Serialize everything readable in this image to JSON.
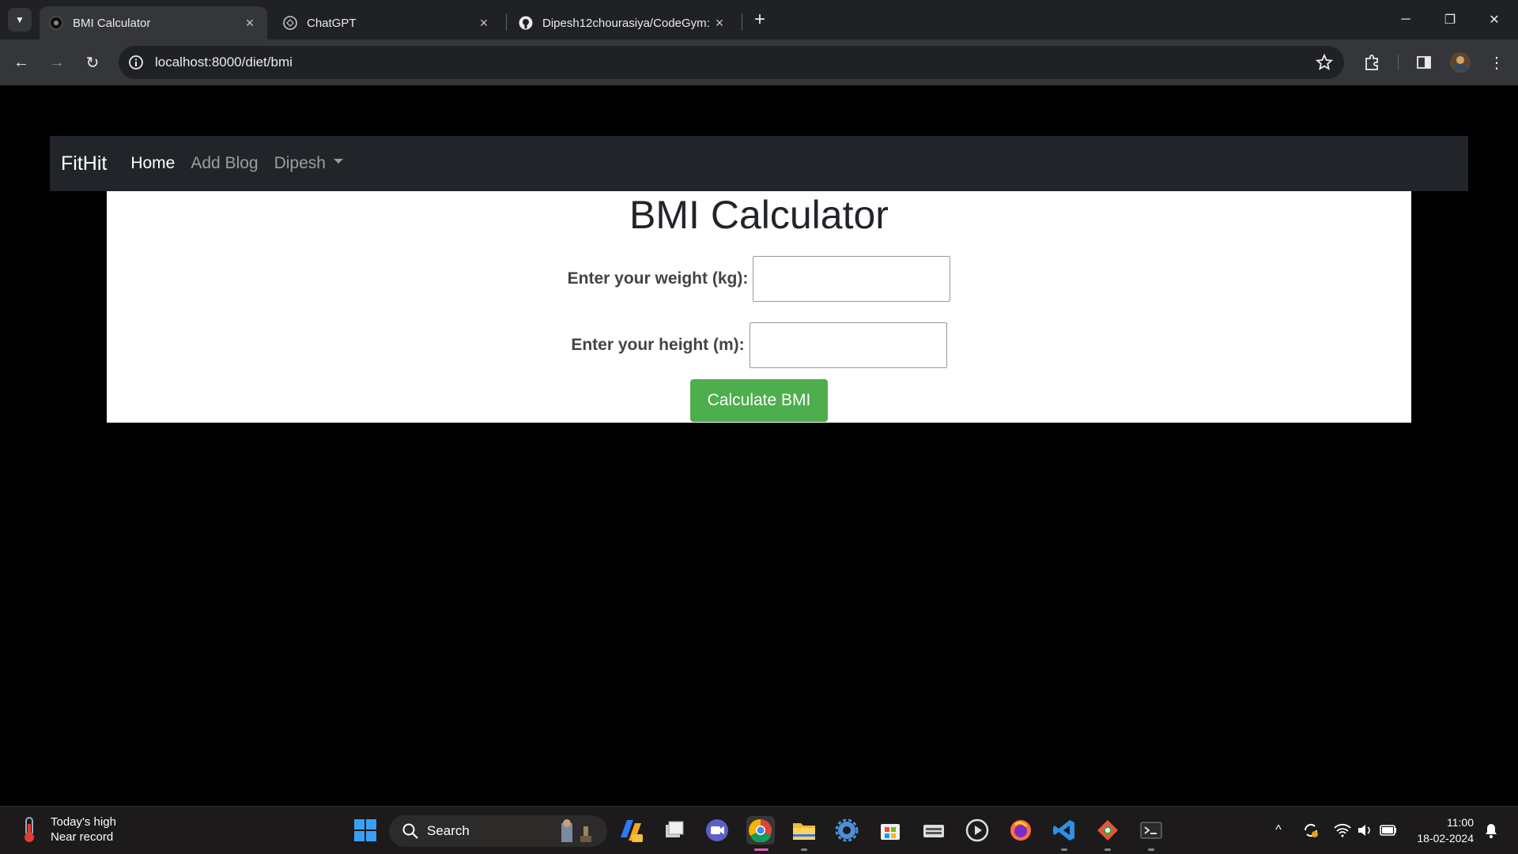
{
  "browser": {
    "tabs": [
      {
        "title": "BMI Calculator",
        "active": true
      },
      {
        "title": "ChatGPT",
        "active": false
      },
      {
        "title": "Dipesh12chourasiya/CodeGym:",
        "active": false
      }
    ],
    "url": "localhost:8000/diet/bmi"
  },
  "page": {
    "navbar": {
      "brand": "FitHit",
      "links": [
        "Home",
        "Add Blog",
        "Dipesh"
      ]
    },
    "title": "BMI Calculator",
    "form": {
      "weight_label": "Enter your weight (kg):",
      "weight_value": "",
      "height_label": "Enter your height (m):",
      "height_value": "",
      "submit_label": "Calculate BMI"
    }
  },
  "taskbar": {
    "weather": {
      "line1": "Today's high",
      "line2": "Near record"
    },
    "search_label": "Search",
    "time": "11:00",
    "date": "18-02-2024"
  },
  "colors": {
    "navbar_bg": "#212529",
    "button_green": "#4cae4c",
    "chrome_bg": "#202124"
  }
}
